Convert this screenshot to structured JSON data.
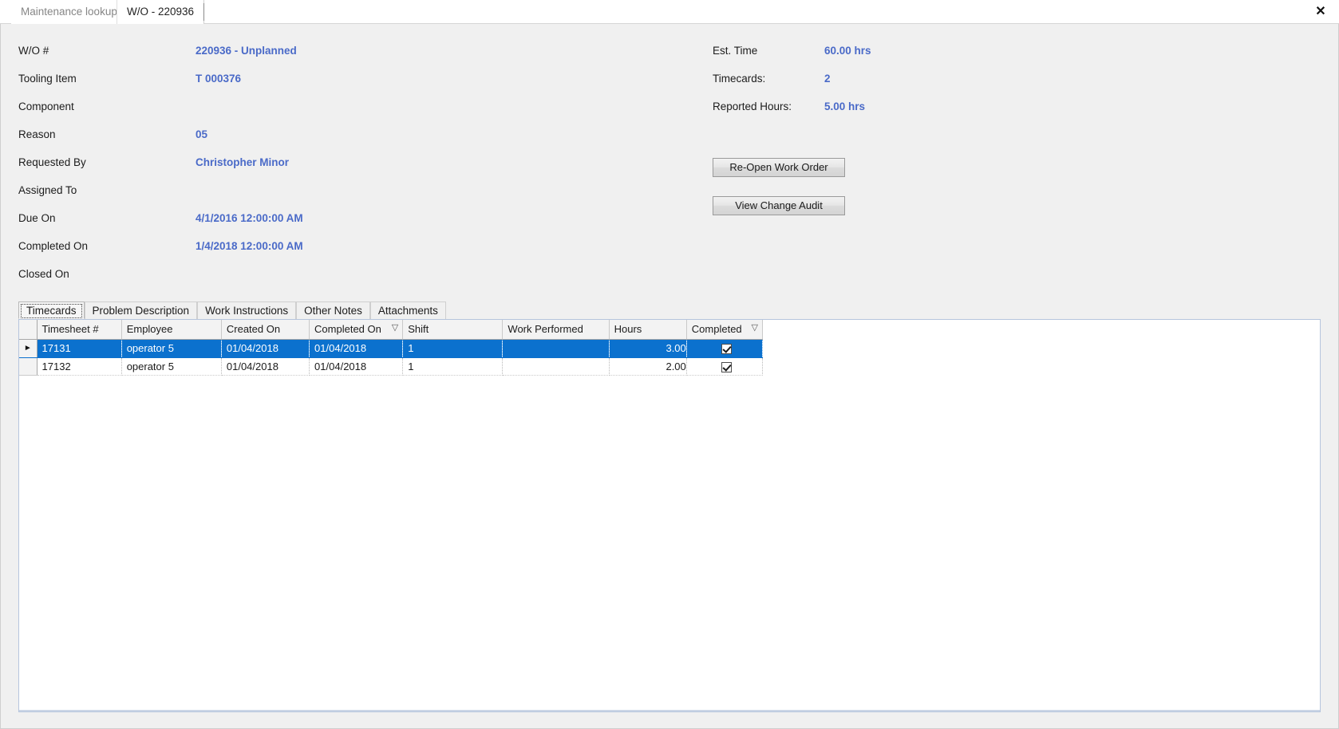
{
  "window": {
    "close_label": "✕"
  },
  "doc_tabs": [
    {
      "label": "Maintenance lookup",
      "active": false
    },
    {
      "label": "W/O - 220936",
      "active": true
    }
  ],
  "form": {
    "fields": [
      {
        "label": "W/O #",
        "value": "220936 - Unplanned"
      },
      {
        "label": "Tooling Item",
        "value": "T 000376"
      },
      {
        "label": "Component",
        "value": ""
      },
      {
        "label": "Reason",
        "value": "05"
      },
      {
        "label": "Requested By",
        "value": "Christopher Minor"
      },
      {
        "label": "Assigned To",
        "value": ""
      },
      {
        "label": "Due On",
        "value": "4/1/2016 12:00:00 AM"
      },
      {
        "label": "Completed On",
        "value": "1/4/2018 12:00:00 AM"
      },
      {
        "label": "Closed On",
        "value": ""
      }
    ],
    "summary": [
      {
        "label": "Est. Time",
        "value": "60.00 hrs"
      },
      {
        "label": "Timecards:",
        "value": "2"
      },
      {
        "label": "Reported Hours:",
        "value": "5.00 hrs"
      }
    ],
    "buttons": [
      {
        "label": "Re-Open Work Order"
      },
      {
        "label": "View Change Audit"
      }
    ]
  },
  "inner_tabs": [
    {
      "label": "Timecards",
      "selected": true
    },
    {
      "label": "Problem Description",
      "selected": false
    },
    {
      "label": "Work Instructions",
      "selected": false
    },
    {
      "label": "Other Notes",
      "selected": false
    },
    {
      "label": "Attachments",
      "selected": false
    }
  ],
  "grid": {
    "columns": [
      {
        "label": "Timesheet #",
        "sorted": false
      },
      {
        "label": "Employee",
        "sorted": false
      },
      {
        "label": "Created On",
        "sorted": false
      },
      {
        "label": "Completed On",
        "sorted": true
      },
      {
        "label": "Shift",
        "sorted": false
      },
      {
        "label": "Work Performed",
        "sorted": false
      },
      {
        "label": "Hours",
        "sorted": false
      },
      {
        "label": "Completed",
        "sorted": true
      }
    ],
    "sort_glyph": "▽",
    "row_pointer": "►",
    "rows": [
      {
        "selected": true,
        "timesheet": "17131",
        "employee": "operator 5",
        "created_on": "01/04/2018",
        "completed_on": "01/04/2018",
        "shift": "1",
        "work_performed": "",
        "hours": "3.00",
        "completed": true
      },
      {
        "selected": false,
        "timesheet": "17132",
        "employee": "operator 5",
        "created_on": "01/04/2018",
        "completed_on": "01/04/2018",
        "shift": "1",
        "work_performed": "",
        "hours": "2.00",
        "completed": true
      }
    ]
  },
  "colors": {
    "value_blue": "#4a6ac8",
    "selection_blue": "#0b71ce",
    "form_background": "#f0f0f0"
  }
}
